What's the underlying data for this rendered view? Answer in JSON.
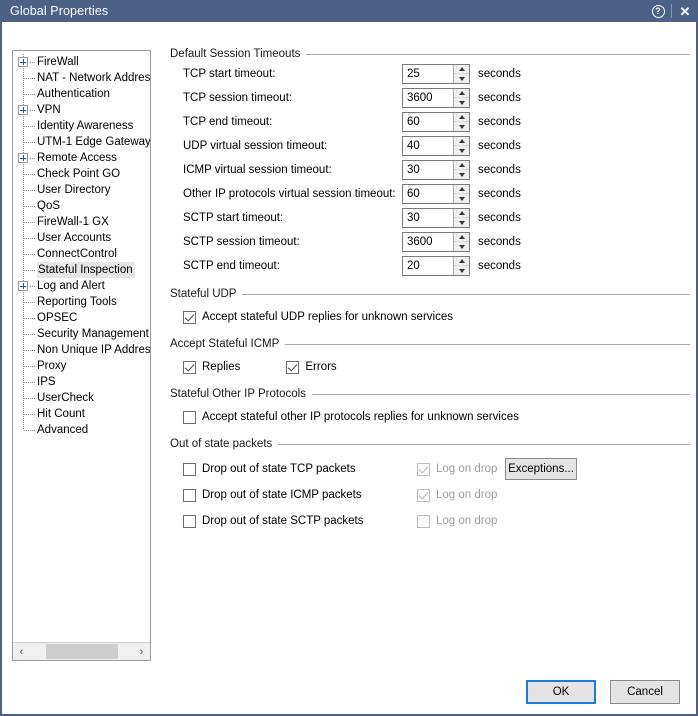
{
  "window": {
    "title": "Global Properties",
    "help_icon": "help-circle-icon",
    "close_icon": "close-icon",
    "help_glyph": "?",
    "close_glyph": "✕",
    "accent_titlebar": "#4d6188",
    "focus_blue": "#1f7bd1"
  },
  "sidebar": {
    "scroll_left_glyph": "‹",
    "scroll_right_glyph": "›",
    "items": [
      {
        "label": "FireWall",
        "expandable": true,
        "selected": false
      },
      {
        "label": "NAT - Network Addres",
        "expandable": false,
        "selected": false
      },
      {
        "label": "Authentication",
        "expandable": false,
        "selected": false
      },
      {
        "label": "VPN",
        "expandable": true,
        "selected": false
      },
      {
        "label": "Identity Awareness",
        "expandable": false,
        "selected": false
      },
      {
        "label": "UTM-1 Edge Gateway",
        "expandable": false,
        "selected": false
      },
      {
        "label": "Remote Access",
        "expandable": true,
        "selected": false
      },
      {
        "label": "Check Point GO",
        "expandable": false,
        "selected": false
      },
      {
        "label": "User Directory",
        "expandable": false,
        "selected": false
      },
      {
        "label": "QoS",
        "expandable": false,
        "selected": false
      },
      {
        "label": "FireWall-1 GX",
        "expandable": false,
        "selected": false
      },
      {
        "label": "User Accounts",
        "expandable": false,
        "selected": false
      },
      {
        "label": "ConnectControl",
        "expandable": false,
        "selected": false
      },
      {
        "label": "Stateful Inspection",
        "expandable": false,
        "selected": true
      },
      {
        "label": "Log and Alert",
        "expandable": true,
        "selected": false
      },
      {
        "label": "Reporting Tools",
        "expandable": false,
        "selected": false
      },
      {
        "label": "OPSEC",
        "expandable": false,
        "selected": false
      },
      {
        "label": "Security Management .",
        "expandable": false,
        "selected": false
      },
      {
        "label": "Non Unique IP Address",
        "expandable": false,
        "selected": false
      },
      {
        "label": "Proxy",
        "expandable": false,
        "selected": false
      },
      {
        "label": "IPS",
        "expandable": false,
        "selected": false
      },
      {
        "label": "UserCheck",
        "expandable": false,
        "selected": false
      },
      {
        "label": "Hit Count",
        "expandable": false,
        "selected": false
      },
      {
        "label": "Advanced",
        "expandable": false,
        "selected": false
      }
    ]
  },
  "main": {
    "timeouts": {
      "title": "Default Session Timeouts",
      "unit": "seconds",
      "rows": [
        {
          "label": "TCP start timeout:",
          "value": "25"
        },
        {
          "label": "TCP session timeout:",
          "value": "3600"
        },
        {
          "label": "TCP end timeout:",
          "value": "60"
        },
        {
          "label": "UDP virtual session timeout:",
          "value": "40"
        },
        {
          "label": "ICMP virtual session timeout:",
          "value": "30"
        },
        {
          "label": "Other IP protocols virtual session timeout:",
          "value": "60"
        },
        {
          "label": "SCTP start timeout:",
          "value": "30"
        },
        {
          "label": "SCTP session timeout:",
          "value": "3600"
        },
        {
          "label": "SCTP end timeout:",
          "value": "20"
        }
      ]
    },
    "stateful_udp": {
      "title": "Stateful UDP",
      "accept": {
        "label": "Accept stateful UDP replies for unknown services",
        "checked": true
      }
    },
    "stateful_icmp": {
      "title": "Accept Stateful ICMP",
      "replies": {
        "label": "Replies",
        "checked": true
      },
      "errors": {
        "label": "Errors",
        "checked": true
      }
    },
    "stateful_other": {
      "title": "Stateful Other IP Protocols",
      "accept": {
        "label": "Accept stateful other IP protocols replies for unknown services",
        "checked": false
      }
    },
    "out_of_state": {
      "title": "Out of state packets",
      "exceptions_label": "Exceptions...",
      "log_label": "Log on drop",
      "rows": [
        {
          "label": "Drop out of state TCP packets",
          "checked": false,
          "log_checked": true,
          "log_disabled": true
        },
        {
          "label": "Drop out of state ICMP packets",
          "checked": false,
          "log_checked": true,
          "log_disabled": true
        },
        {
          "label": "Drop out of state SCTP packets",
          "checked": false,
          "log_checked": false,
          "log_disabled": true
        }
      ]
    }
  },
  "footer": {
    "ok_label": "OK",
    "cancel_label": "Cancel"
  }
}
